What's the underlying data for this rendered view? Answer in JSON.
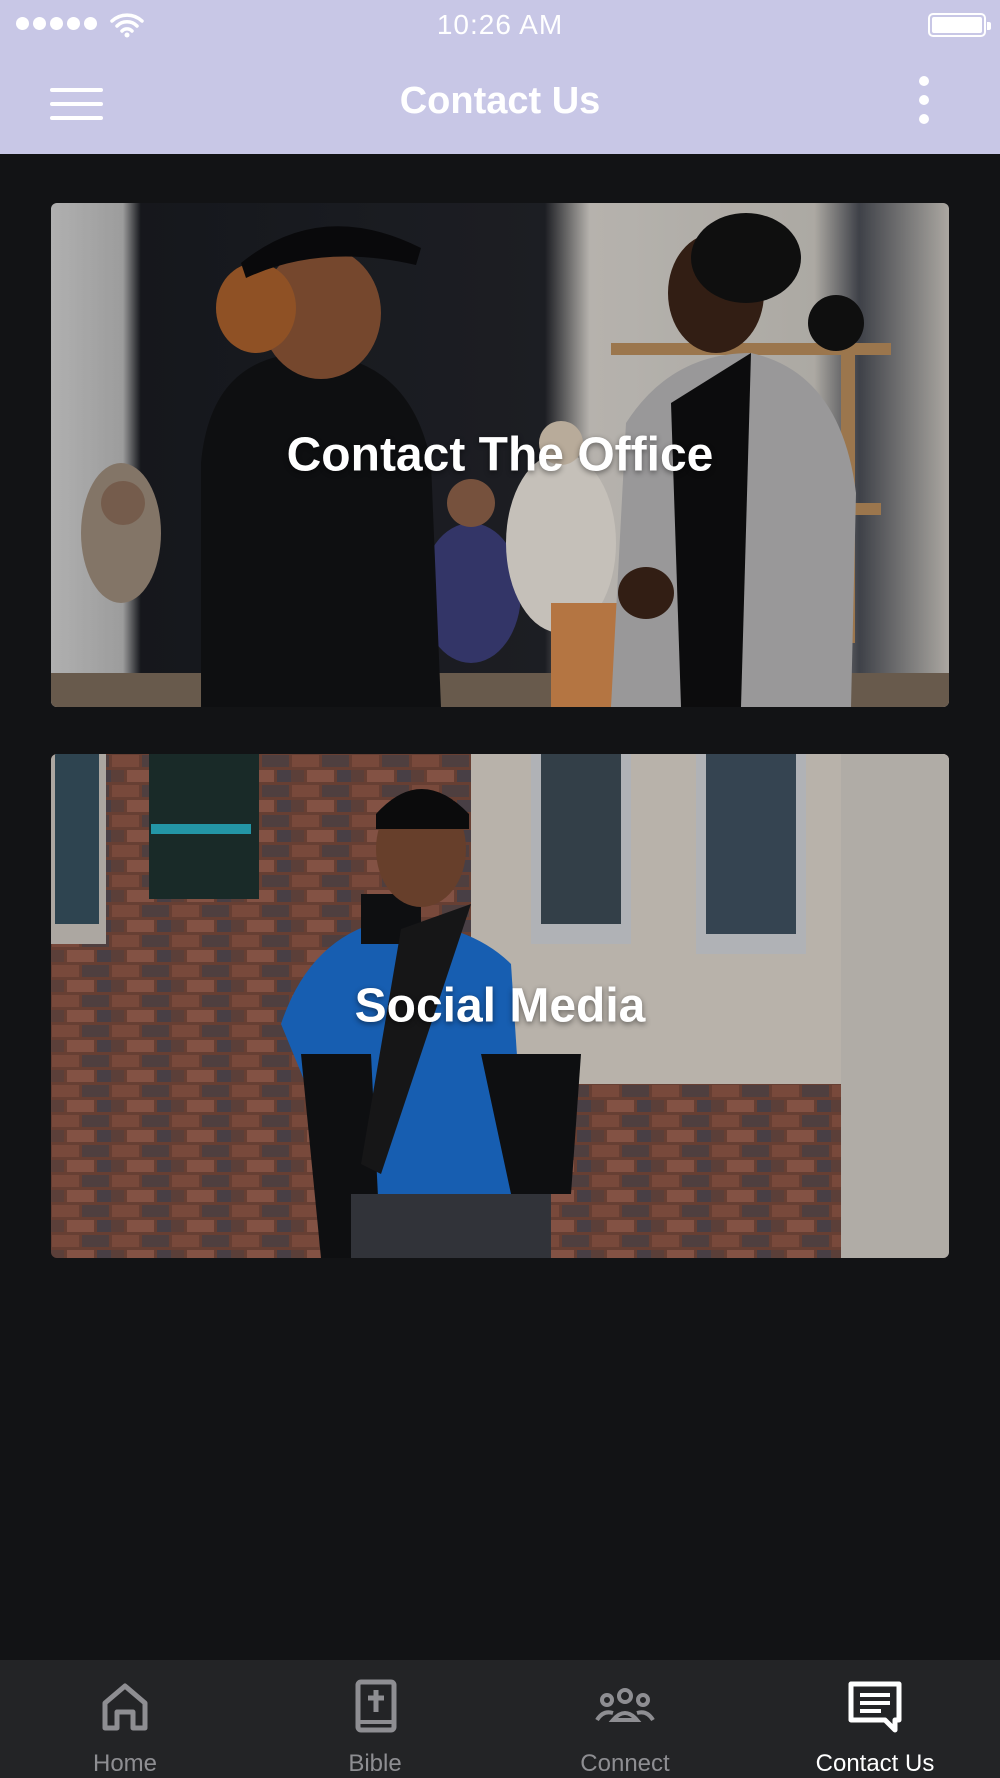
{
  "status_bar": {
    "time": "10:26 AM"
  },
  "header": {
    "title": "Contact Us",
    "menu_icon": "hamburger-menu-icon",
    "more_icon": "more-vertical-icon"
  },
  "cards": [
    {
      "label": "Contact The Office",
      "image": "two-women-talking-photo"
    },
    {
      "label": "Social Media",
      "image": "man-in-blue-tshirt-photo"
    }
  ],
  "tabs": [
    {
      "label": "Home",
      "icon": "home-icon",
      "active": false
    },
    {
      "label": "Bible",
      "icon": "bible-icon",
      "active": false
    },
    {
      "label": "Connect",
      "icon": "group-icon",
      "active": false
    },
    {
      "label": "Contact Us",
      "icon": "message-icon",
      "active": true
    }
  ],
  "colors": {
    "header_bg": "#c8c7e6",
    "page_bg": "#121315",
    "tabbar_bg": "#232426"
  }
}
